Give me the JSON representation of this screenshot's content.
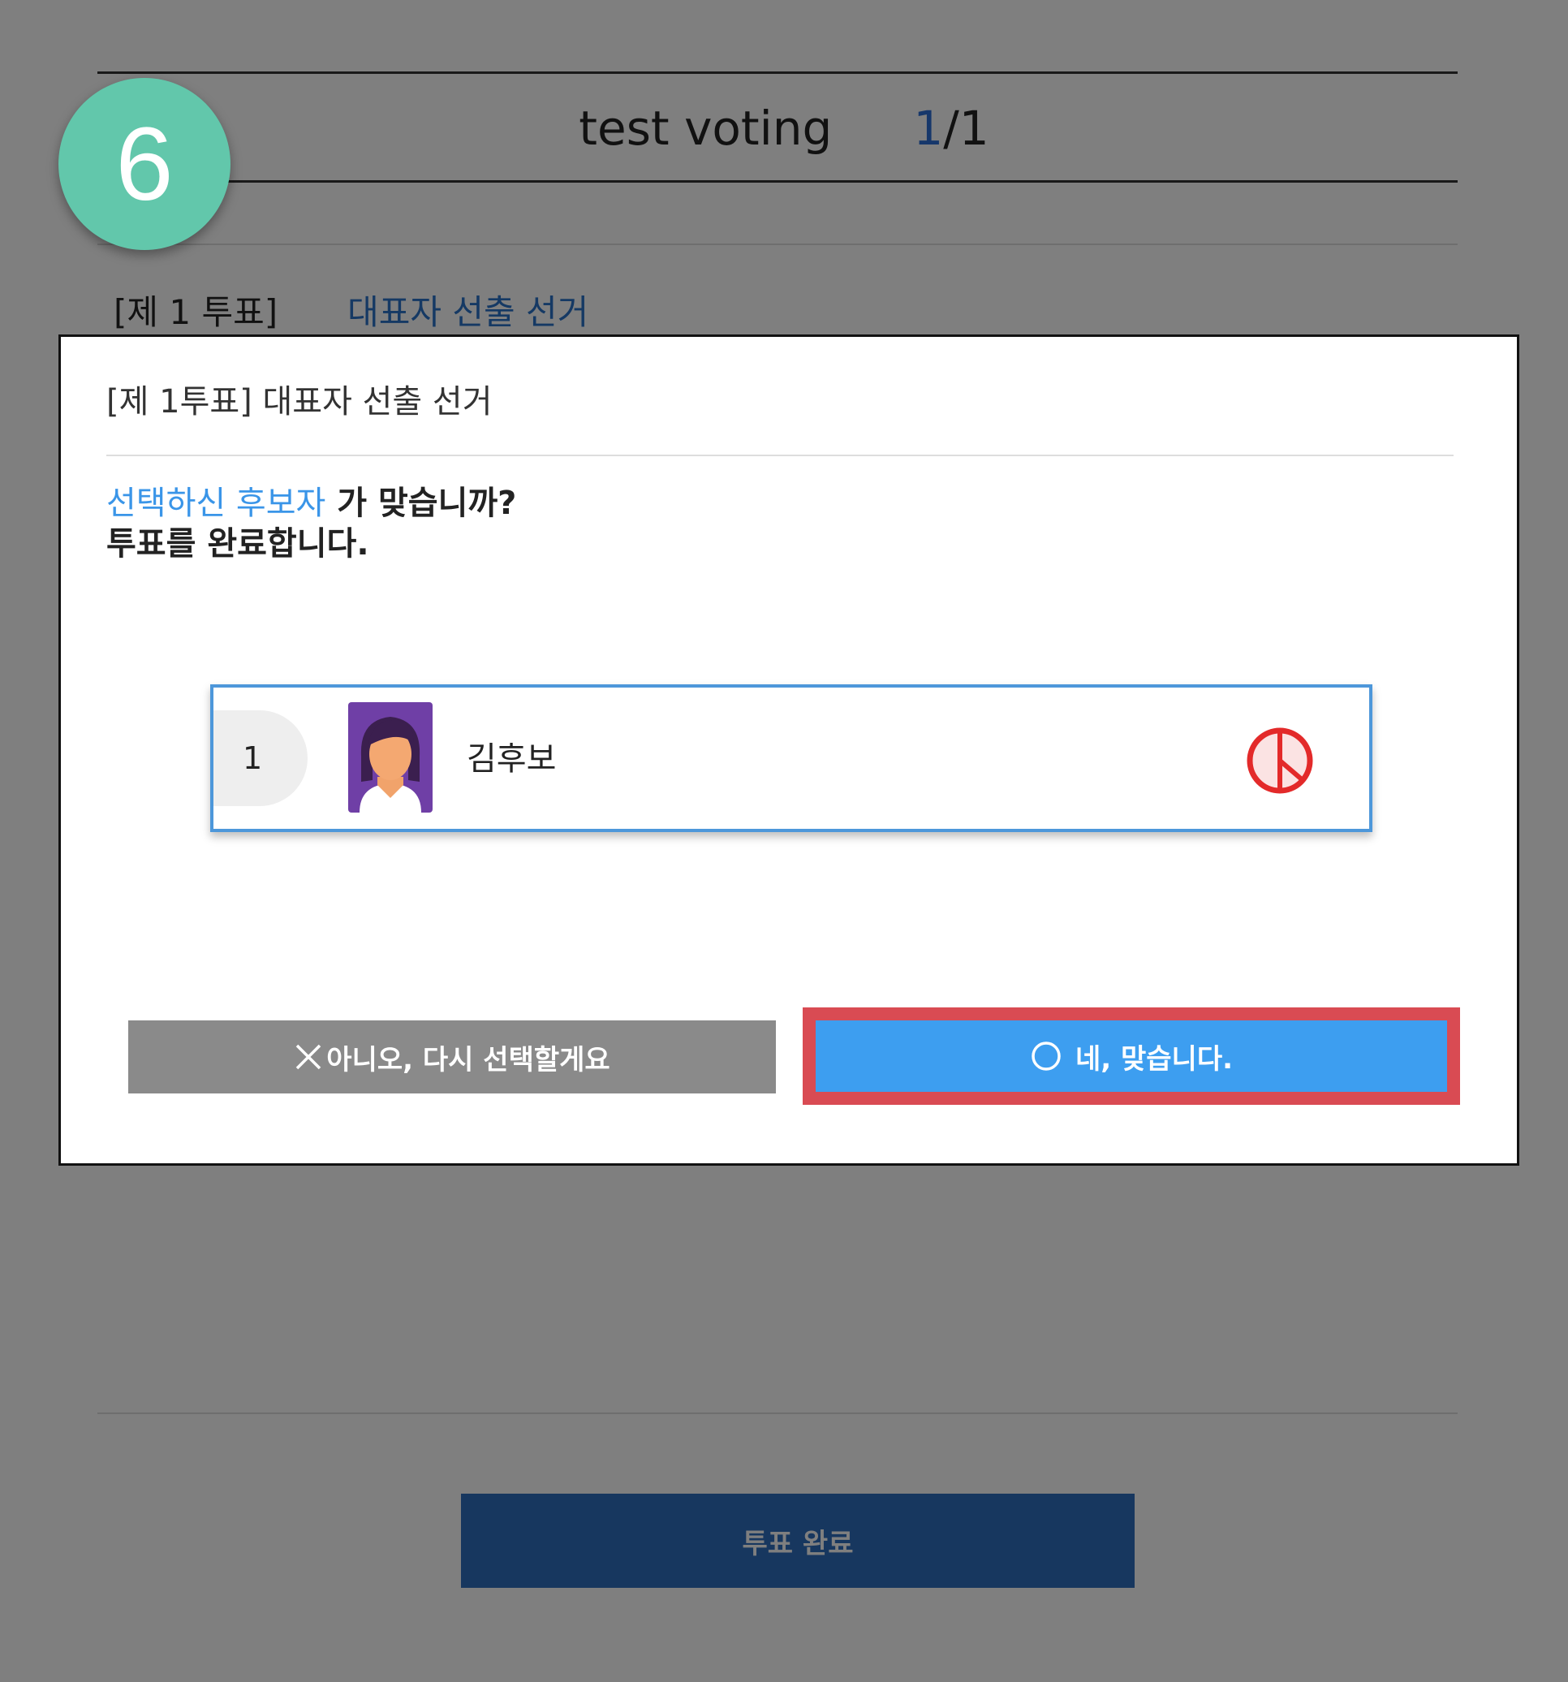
{
  "header": {
    "title": "test voting",
    "page_current": "1",
    "page_total": "/1"
  },
  "vote": {
    "number_label": "[제 1 투표]",
    "name": "대표자 선출 선거"
  },
  "footer": {
    "complete_label": "투표 완료"
  },
  "step_badge": "6",
  "modal": {
    "title": "[제 1투표] 대표자 선출 선거",
    "question_highlight": "선택하신 후보자",
    "question_rest": " 가 맞습니까?",
    "question_line2": "투표를 완료합니다.",
    "candidate": {
      "number": "1",
      "name": "김후보",
      "stamp_icon": "ballot-stamp-icon",
      "photo_icon": "avatar-icon"
    },
    "no_button": "아니오, 다시 선택할게요",
    "yes_button": "네, 맞습니다."
  },
  "colors": {
    "accent_blue": "#3d9ef0",
    "highlight_red": "#d94b53",
    "badge_green": "#62c7ab",
    "no_button_gray": "#8a8a8a"
  }
}
